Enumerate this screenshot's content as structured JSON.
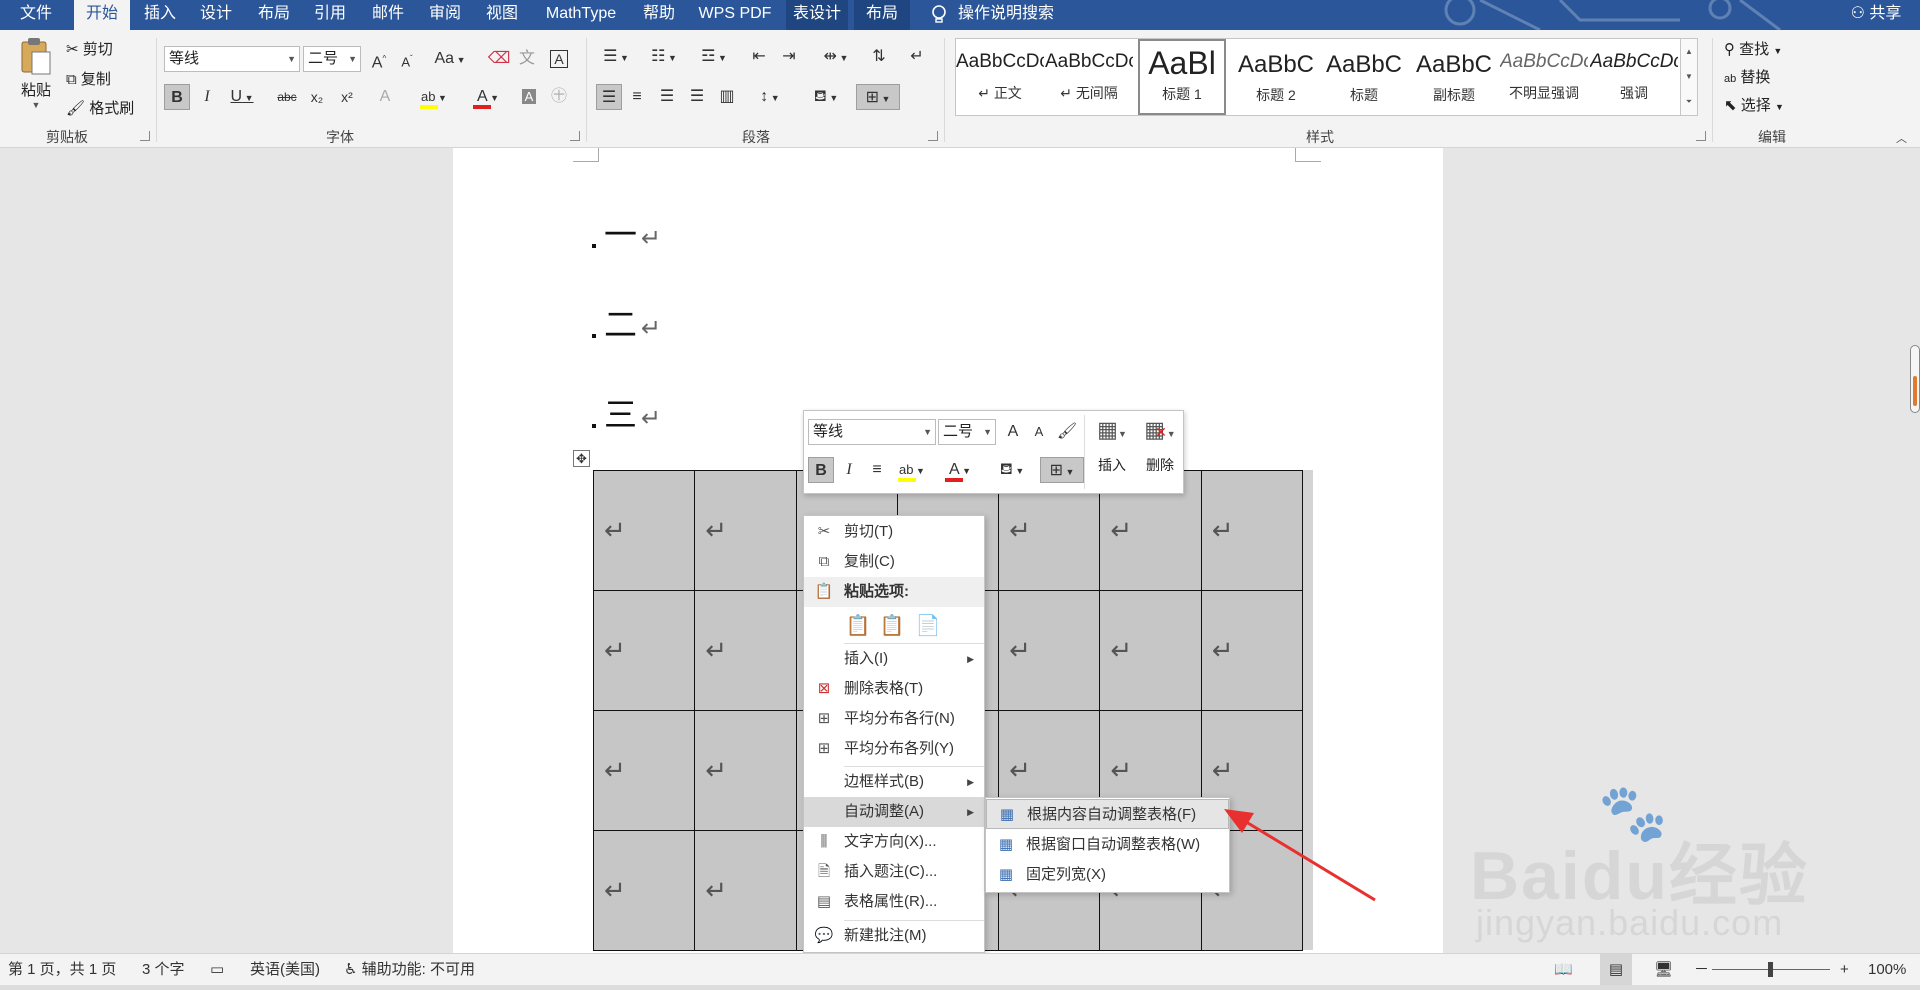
{
  "tabs": [
    {
      "label": "文件"
    },
    {
      "label": "开始"
    },
    {
      "label": "插入"
    },
    {
      "label": "设计"
    },
    {
      "label": "布局"
    },
    {
      "label": "引用"
    },
    {
      "label": "邮件"
    },
    {
      "label": "审阅"
    },
    {
      "label": "视图"
    },
    {
      "label": "MathType"
    },
    {
      "label": "帮助"
    },
    {
      "label": "WPS PDF"
    },
    {
      "label": "表设计"
    },
    {
      "label": "布局"
    }
  ],
  "tell_me": "操作说明搜索",
  "share": "共享",
  "clipboard": {
    "paste": "粘贴",
    "cut": "剪切",
    "copy": "复制",
    "format_painter": "格式刷",
    "group": "剪贴板"
  },
  "font": {
    "name": "等线",
    "size": "二号",
    "group": "字体",
    "bold": "B",
    "italic": "I",
    "underline": "U",
    "strike": "abc",
    "subscript": "x₂",
    "superscript": "x²",
    "grow": "A",
    "shrink": "A",
    "change_case": "Aa",
    "color_swatch": "#e02020",
    "highlight_swatch": "#ffff00"
  },
  "paragraph": {
    "group": "段落"
  },
  "styles": {
    "group": "样式",
    "items": [
      {
        "sample": "AaBbCcDc",
        "name": "正文"
      },
      {
        "sample": "AaBbCcDc",
        "name": "无间隔"
      },
      {
        "sample": "AaBl",
        "name": "标题 1"
      },
      {
        "sample": "AaBbC",
        "name": "标题 2"
      },
      {
        "sample": "AaBbC",
        "name": "标题"
      },
      {
        "sample": "AaBbC",
        "name": "副标题"
      },
      {
        "sample": "AaBbCcDc",
        "name": "不明显强调"
      },
      {
        "sample": "AaBbCcDc",
        "name": "强调"
      }
    ]
  },
  "editing": {
    "find": "查找",
    "replace": "替换",
    "select": "选择",
    "group": "编辑"
  },
  "document": {
    "paragraphs": [
      "一",
      "二",
      "三"
    ],
    "return_mark": "↵",
    "table": {
      "rows": 4,
      "cols": 7
    }
  },
  "mini_toolbar": {
    "font": "等线",
    "size": "二号",
    "insert": "插入",
    "delete": "删除"
  },
  "context_menu": {
    "cut": "剪切(T)",
    "copy": "复制(C)",
    "paste_options": "粘贴选项:",
    "insert": "插入(I)",
    "delete_table": "删除表格(T)",
    "distribute_rows": "平均分布各行(N)",
    "distribute_cols": "平均分布各列(Y)",
    "border_styles": "边框样式(B)",
    "autofit": "自动调整(A)",
    "text_direction": "文字方向(X)...",
    "insert_caption": "插入题注(C)...",
    "table_properties": "表格属性(R)...",
    "new_comment": "新建批注(M)"
  },
  "autofit_submenu": {
    "by_content": "根据内容自动调整表格(F)",
    "by_window": "根据窗口自动调整表格(W)",
    "fixed": "固定列宽(X)"
  },
  "watermark": {
    "brand": "Baidu经验",
    "url": "jingyan.baidu.com"
  },
  "status": {
    "page": "第 1 页，共 1 页",
    "words": "3 个字",
    "language": "英语(美国)",
    "accessibility": "辅助功能: 不可用",
    "zoom": "100%",
    "zoom_minus": "－",
    "zoom_plus": "+"
  },
  "colors": {
    "title_bar": "#2b579a",
    "context_tab": "#1f4680",
    "arrow": "#e8312f",
    "table_fill": "#c6c6c6"
  }
}
